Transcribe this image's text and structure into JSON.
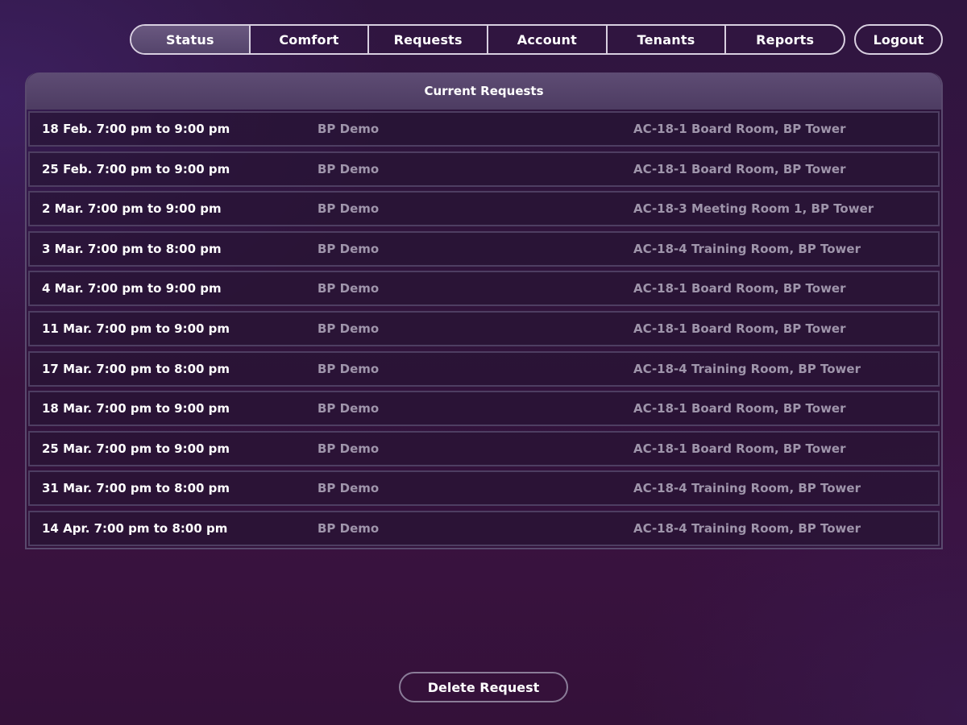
{
  "nav": {
    "tabs": [
      {
        "label": "Status",
        "active": true
      },
      {
        "label": "Comfort",
        "active": false
      },
      {
        "label": "Requests",
        "active": false
      },
      {
        "label": "Account",
        "active": false
      },
      {
        "label": "Tenants",
        "active": false
      },
      {
        "label": "Reports",
        "active": false
      }
    ],
    "logout_label": "Logout"
  },
  "panel": {
    "title": "Current Requests",
    "requests": [
      {
        "time": "18 Feb. 7:00 pm to 9:00 pm",
        "tenant": "BP Demo",
        "room": "AC-18-1 Board Room, BP Tower"
      },
      {
        "time": "25 Feb. 7:00 pm to 9:00 pm",
        "tenant": "BP Demo",
        "room": "AC-18-1 Board Room, BP Tower"
      },
      {
        "time": "2 Mar. 7:00 pm to 9:00 pm",
        "tenant": "BP Demo",
        "room": "AC-18-3 Meeting Room 1, BP Tower"
      },
      {
        "time": "3 Mar. 7:00 pm to 8:00 pm",
        "tenant": "BP Demo",
        "room": "AC-18-4 Training Room, BP Tower"
      },
      {
        "time": "4 Mar. 7:00 pm to 9:00 pm",
        "tenant": "BP Demo",
        "room": "AC-18-1 Board Room, BP Tower"
      },
      {
        "time": "11 Mar. 7:00 pm to 9:00 pm",
        "tenant": "BP Demo",
        "room": "AC-18-1 Board Room, BP Tower"
      },
      {
        "time": "17 Mar. 7:00 pm to 8:00 pm",
        "tenant": "BP Demo",
        "room": "AC-18-4 Training Room, BP Tower"
      },
      {
        "time": "18 Mar. 7:00 pm to 9:00 pm",
        "tenant": "BP Demo",
        "room": "AC-18-1 Board Room, BP Tower"
      },
      {
        "time": "25 Mar. 7:00 pm to 9:00 pm",
        "tenant": "BP Demo",
        "room": "AC-18-1 Board Room, BP Tower"
      },
      {
        "time": "31 Mar. 7:00 pm to 8:00 pm",
        "tenant": "BP Demo",
        "room": "AC-18-4 Training Room, BP Tower"
      },
      {
        "time": "14 Apr. 7:00 pm to 8:00 pm",
        "tenant": "BP Demo",
        "room": "AC-18-4 Training Room, BP Tower"
      }
    ]
  },
  "actions": {
    "delete_label": "Delete Request"
  },
  "colors": {
    "accent_border": "#d8cfe0",
    "active_tab": "#5f4e76",
    "muted_text": "#9f95ab"
  }
}
